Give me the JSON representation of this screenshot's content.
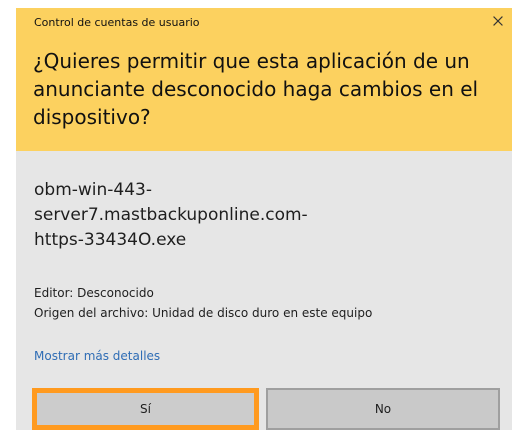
{
  "dialog": {
    "window_title": "Control de cuentas de usuario",
    "question_line_1": "¿Quieres permitir que esta aplicación de un",
    "question_line_2": "anunciante desconocido haga cambios en el",
    "question_line_3": "dispositivo?",
    "filename_lines": [
      "obm-win-443-",
      "server7.mastbackuponline.com-",
      "https-33434O.exe"
    ],
    "publisher": "Editor: Desconocido",
    "file_origin": "Origen del archivo: Unidad de disco duro en este equipo",
    "more_details": "Mostrar más detalles",
    "buttons": {
      "yes": "Sí",
      "no": "No"
    },
    "icons": {
      "close": "close-icon"
    },
    "colors": {
      "header_background": "#fcd15f",
      "body_background": "#e6e6e6",
      "link": "#2f6db5",
      "focus_highlight": "#ff9a1f",
      "button_background": "#c9c9c9",
      "button_border": "#9f9f9f"
    }
  }
}
